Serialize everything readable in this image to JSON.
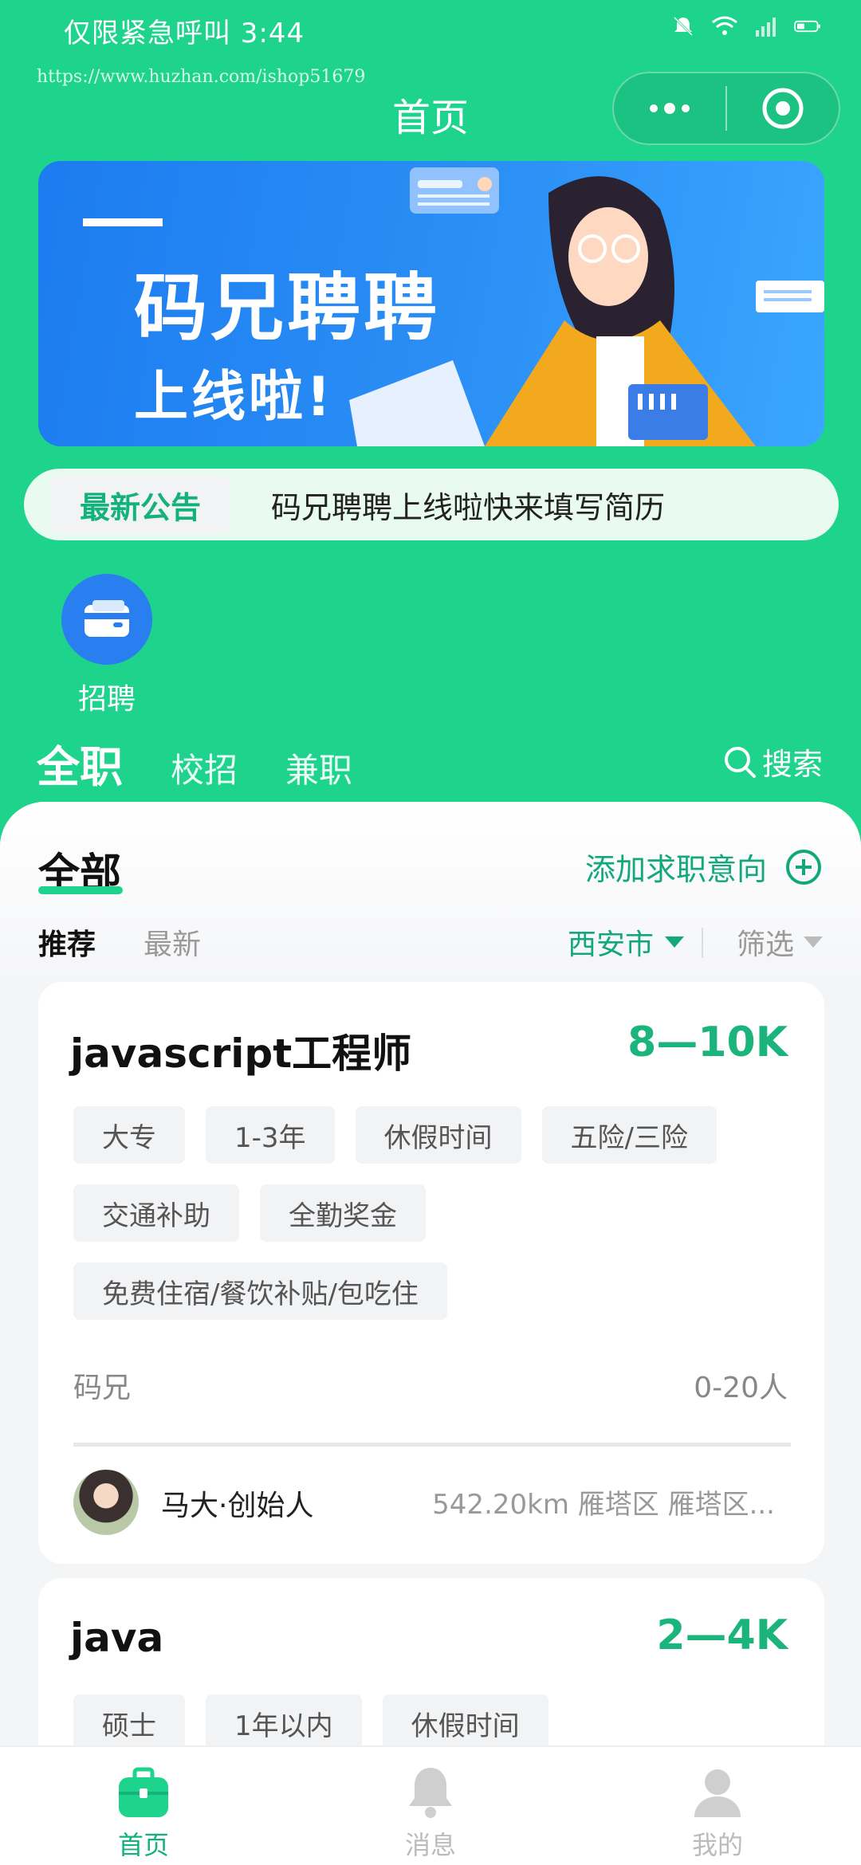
{
  "status_bar": {
    "left_text": "仅限紧急呼叫 3:44"
  },
  "watermark": "https://www.huzhan.com/ishop51679",
  "nav": {
    "title": "首页"
  },
  "banner": {
    "title_line1": "码兄聘聘",
    "title_line2": "上线啦!"
  },
  "notice": {
    "tag": "最新公告",
    "text": "码兄聘聘上线啦快来填写简历"
  },
  "quick_entries": [
    {
      "label": "招聘",
      "icon": "wallet-icon"
    }
  ],
  "type_tabs": [
    {
      "label": "全职",
      "active": true
    },
    {
      "label": "校招"
    },
    {
      "label": "兼职"
    }
  ],
  "search_label": "搜索",
  "panel": {
    "title": "全部",
    "add_intent": "添加求职意向",
    "sort": {
      "recommend": "推荐",
      "latest": "最新"
    },
    "city": "西安市",
    "filter": "筛选"
  },
  "jobs": [
    {
      "title": "javascript工程师",
      "salary": "8—10K",
      "tags": [
        "大专",
        "1-3年",
        "休假时间",
        "五险/三险",
        "交通补助",
        "全勤奖金",
        "免费住宿/餐饮补贴/包吃住"
      ],
      "company": "码兄",
      "size": "0-20人",
      "recruiter": "马大·创始人",
      "location": "542.20km 雁塔区 雁塔区..."
    },
    {
      "title": "java",
      "salary": "2—4K",
      "tags": [
        "硕士",
        "1年以内",
        "休假时间"
      ]
    }
  ],
  "bottom_nav": [
    {
      "label": "首页",
      "icon": "briefcase-icon",
      "active": true
    },
    {
      "label": "消息",
      "icon": "bell-icon"
    },
    {
      "label": "我的",
      "icon": "person-icon"
    }
  ],
  "colors": {
    "brand": "#1ed38c",
    "accent": "#12b27a",
    "banner_blue": "#2a7ff0"
  }
}
